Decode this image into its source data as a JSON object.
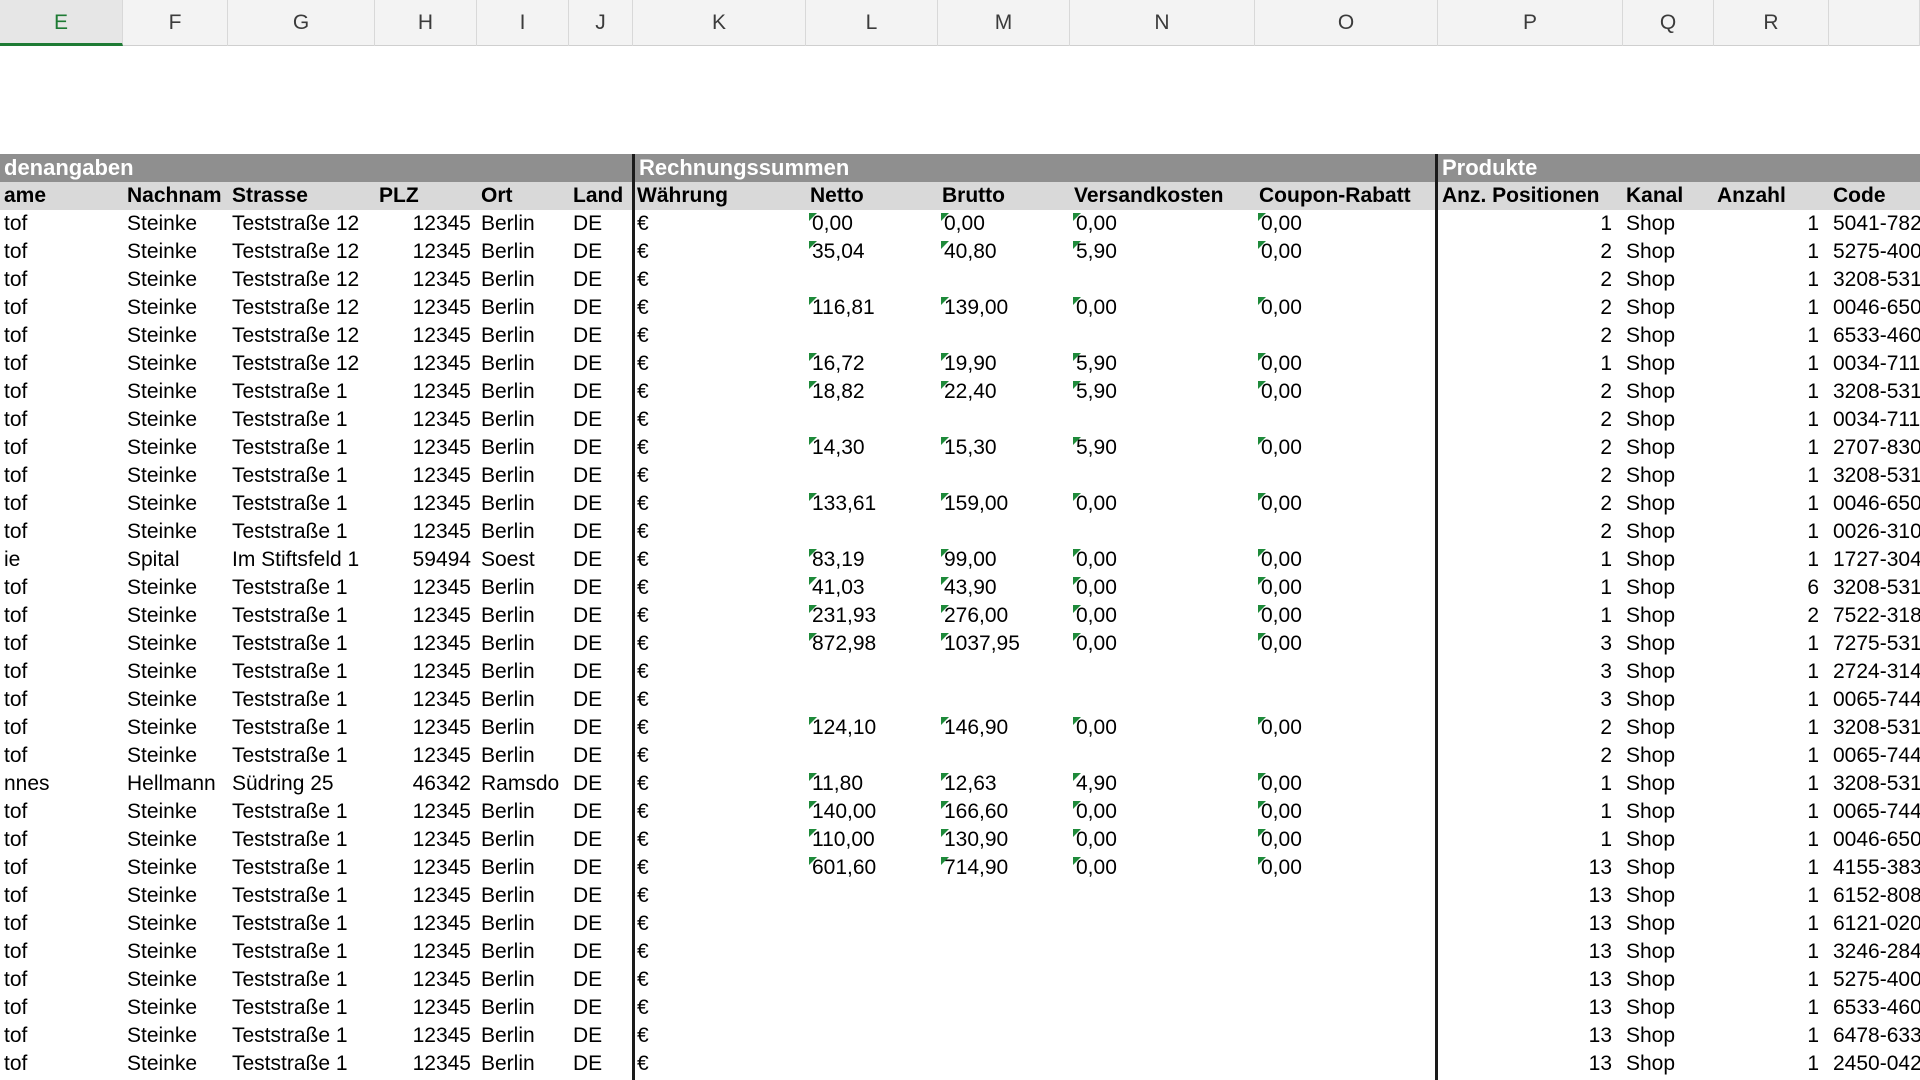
{
  "columns": [
    {
      "letter": "E",
      "active": true
    },
    {
      "letter": "F"
    },
    {
      "letter": "G"
    },
    {
      "letter": "H"
    },
    {
      "letter": "I"
    },
    {
      "letter": "J"
    },
    {
      "letter": "K"
    },
    {
      "letter": "L"
    },
    {
      "letter": "M"
    },
    {
      "letter": "N"
    },
    {
      "letter": "O"
    },
    {
      "letter": "P"
    },
    {
      "letter": "Q"
    },
    {
      "letter": "R"
    },
    {
      "letter": ""
    }
  ],
  "sections": {
    "kundenangaben": "denangaben",
    "rechnungssummen": "Rechnungssummen",
    "produkte": "Produkte"
  },
  "headers": [
    "ame",
    "Nachnam",
    "Strasse",
    "PLZ",
    "Ort",
    "Land",
    "Währung",
    "Netto",
    "Brutto",
    "Versandkosten",
    "Coupon-Rabatt",
    "Anz. Positionen",
    "Kanal",
    "Anzahl",
    "Code"
  ],
  "rows": [
    [
      "tof",
      "Steinke",
      "Teststraße 12",
      "12345",
      "Berlin",
      "DE",
      "€",
      "0,00",
      "0,00",
      "0,00",
      "0,00",
      "1",
      "Shop",
      "1",
      "5041-782"
    ],
    [
      "tof",
      "Steinke",
      "Teststraße 12",
      "12345",
      "Berlin",
      "DE",
      "€",
      "35,04",
      "40,80",
      "5,90",
      "0,00",
      "2",
      "Shop",
      "1",
      "5275-400"
    ],
    [
      "tof",
      "Steinke",
      "Teststraße 12",
      "12345",
      "Berlin",
      "DE",
      "€",
      "",
      "",
      "",
      "",
      "2",
      "Shop",
      "1",
      "3208-531"
    ],
    [
      "tof",
      "Steinke",
      "Teststraße 12",
      "12345",
      "Berlin",
      "DE",
      "€",
      "116,81",
      "139,00",
      "0,00",
      "0,00",
      "2",
      "Shop",
      "1",
      "0046-650"
    ],
    [
      "tof",
      "Steinke",
      "Teststraße 12",
      "12345",
      "Berlin",
      "DE",
      "€",
      "",
      "",
      "",
      "",
      "2",
      "Shop",
      "1",
      "6533-460"
    ],
    [
      "tof",
      "Steinke",
      "Teststraße 12",
      "12345",
      "Berlin",
      "DE",
      "€",
      "16,72",
      "19,90",
      "5,90",
      "0,00",
      "1",
      "Shop",
      "1",
      "0034-711"
    ],
    [
      "tof",
      "Steinke",
      "Teststraße 1",
      "12345",
      "Berlin",
      "DE",
      "€",
      "18,82",
      "22,40",
      "5,90",
      "0,00",
      "2",
      "Shop",
      "1",
      "3208-531"
    ],
    [
      "tof",
      "Steinke",
      "Teststraße 1",
      "12345",
      "Berlin",
      "DE",
      "€",
      "",
      "",
      "",
      "",
      "2",
      "Shop",
      "1",
      "0034-711"
    ],
    [
      "tof",
      "Steinke",
      "Teststraße 1",
      "12345",
      "Berlin",
      "DE",
      "€",
      "14,30",
      "15,30",
      "5,90",
      "0,00",
      "2",
      "Shop",
      "1",
      "2707-830"
    ],
    [
      "tof",
      "Steinke",
      "Teststraße 1",
      "12345",
      "Berlin",
      "DE",
      "€",
      "",
      "",
      "",
      "",
      "2",
      "Shop",
      "1",
      "3208-531"
    ],
    [
      "tof",
      "Steinke",
      "Teststraße 1",
      "12345",
      "Berlin",
      "DE",
      "€",
      "133,61",
      "159,00",
      "0,00",
      "0,00",
      "2",
      "Shop",
      "1",
      "0046-650"
    ],
    [
      "tof",
      "Steinke",
      "Teststraße 1",
      "12345",
      "Berlin",
      "DE",
      "€",
      "",
      "",
      "",
      "",
      "2",
      "Shop",
      "1",
      "0026-310"
    ],
    [
      "ie",
      "Spital",
      "Im Stiftsfeld 1",
      "59494",
      "Soest",
      "DE",
      "€",
      "83,19",
      "99,00",
      "0,00",
      "0,00",
      "1",
      "Shop",
      "1",
      "1727-304"
    ],
    [
      "tof",
      "Steinke",
      "Teststraße 1",
      "12345",
      "Berlin",
      "DE",
      "€",
      "41,03",
      "43,90",
      "0,00",
      "0,00",
      "1",
      "Shop",
      "6",
      "3208-531"
    ],
    [
      "tof",
      "Steinke",
      "Teststraße 1",
      "12345",
      "Berlin",
      "DE",
      "€",
      "231,93",
      "276,00",
      "0,00",
      "0,00",
      "1",
      "Shop",
      "2",
      "7522-318"
    ],
    [
      "tof",
      "Steinke",
      "Teststraße 1",
      "12345",
      "Berlin",
      "DE",
      "€",
      "872,98",
      "1037,95",
      "0,00",
      "0,00",
      "3",
      "Shop",
      "1",
      "7275-531"
    ],
    [
      "tof",
      "Steinke",
      "Teststraße 1",
      "12345",
      "Berlin",
      "DE",
      "€",
      "",
      "",
      "",
      "",
      "3",
      "Shop",
      "1",
      "2724-314"
    ],
    [
      "tof",
      "Steinke",
      "Teststraße 1",
      "12345",
      "Berlin",
      "DE",
      "€",
      "",
      "",
      "",
      "",
      "3",
      "Shop",
      "1",
      "0065-744"
    ],
    [
      "tof",
      "Steinke",
      "Teststraße 1",
      "12345",
      "Berlin",
      "DE",
      "€",
      "124,10",
      "146,90",
      "0,00",
      "0,00",
      "2",
      "Shop",
      "1",
      "3208-531"
    ],
    [
      "tof",
      "Steinke",
      "Teststraße 1",
      "12345",
      "Berlin",
      "DE",
      "€",
      "",
      "",
      "",
      "",
      "2",
      "Shop",
      "1",
      "0065-744"
    ],
    [
      "nnes",
      "Hellmann",
      "Südring 25",
      "46342",
      "Ramsdo",
      "DE",
      "€",
      "11,80",
      "12,63",
      "4,90",
      "0,00",
      "1",
      "Shop",
      "1",
      "3208-531"
    ],
    [
      "tof",
      "Steinke",
      "Teststraße 1",
      "12345",
      "Berlin",
      "DE",
      "€",
      "140,00",
      "166,60",
      "0,00",
      "0,00",
      "1",
      "Shop",
      "1",
      "0065-744"
    ],
    [
      "tof",
      "Steinke",
      "Teststraße 1",
      "12345",
      "Berlin",
      "DE",
      "€",
      "110,00",
      "130,90",
      "0,00",
      "0,00",
      "1",
      "Shop",
      "1",
      "0046-650"
    ],
    [
      "tof",
      "Steinke",
      "Teststraße 1",
      "12345",
      "Berlin",
      "DE",
      "€",
      "601,60",
      "714,90",
      "0,00",
      "0,00",
      "13",
      "Shop",
      "1",
      "4155-383"
    ],
    [
      "tof",
      "Steinke",
      "Teststraße 1",
      "12345",
      "Berlin",
      "DE",
      "€",
      "",
      "",
      "",
      "",
      "13",
      "Shop",
      "1",
      "6152-808"
    ],
    [
      "tof",
      "Steinke",
      "Teststraße 1",
      "12345",
      "Berlin",
      "DE",
      "€",
      "",
      "",
      "",
      "",
      "13",
      "Shop",
      "1",
      "6121-020"
    ],
    [
      "tof",
      "Steinke",
      "Teststraße 1",
      "12345",
      "Berlin",
      "DE",
      "€",
      "",
      "",
      "",
      "",
      "13",
      "Shop",
      "1",
      "3246-284"
    ],
    [
      "tof",
      "Steinke",
      "Teststraße 1",
      "12345",
      "Berlin",
      "DE",
      "€",
      "",
      "",
      "",
      "",
      "13",
      "Shop",
      "1",
      "5275-400"
    ],
    [
      "tof",
      "Steinke",
      "Teststraße 1",
      "12345",
      "Berlin",
      "DE",
      "€",
      "",
      "",
      "",
      "",
      "13",
      "Shop",
      "1",
      "6533-460"
    ],
    [
      "tof",
      "Steinke",
      "Teststraße 1",
      "12345",
      "Berlin",
      "DE",
      "€",
      "",
      "",
      "",
      "",
      "13",
      "Shop",
      "1",
      "6478-633"
    ],
    [
      "tof",
      "Steinke",
      "Teststraße 1",
      "12345",
      "Berlin",
      "DE",
      "€",
      "",
      "",
      "",
      "",
      "13",
      "Shop",
      "1",
      "2450-042"
    ]
  ],
  "colors": {
    "active_column": "#1e7b34",
    "section_bar": "#8f8f8f",
    "header_row": "#d9d9d9",
    "flag": "#1e8a3a"
  }
}
